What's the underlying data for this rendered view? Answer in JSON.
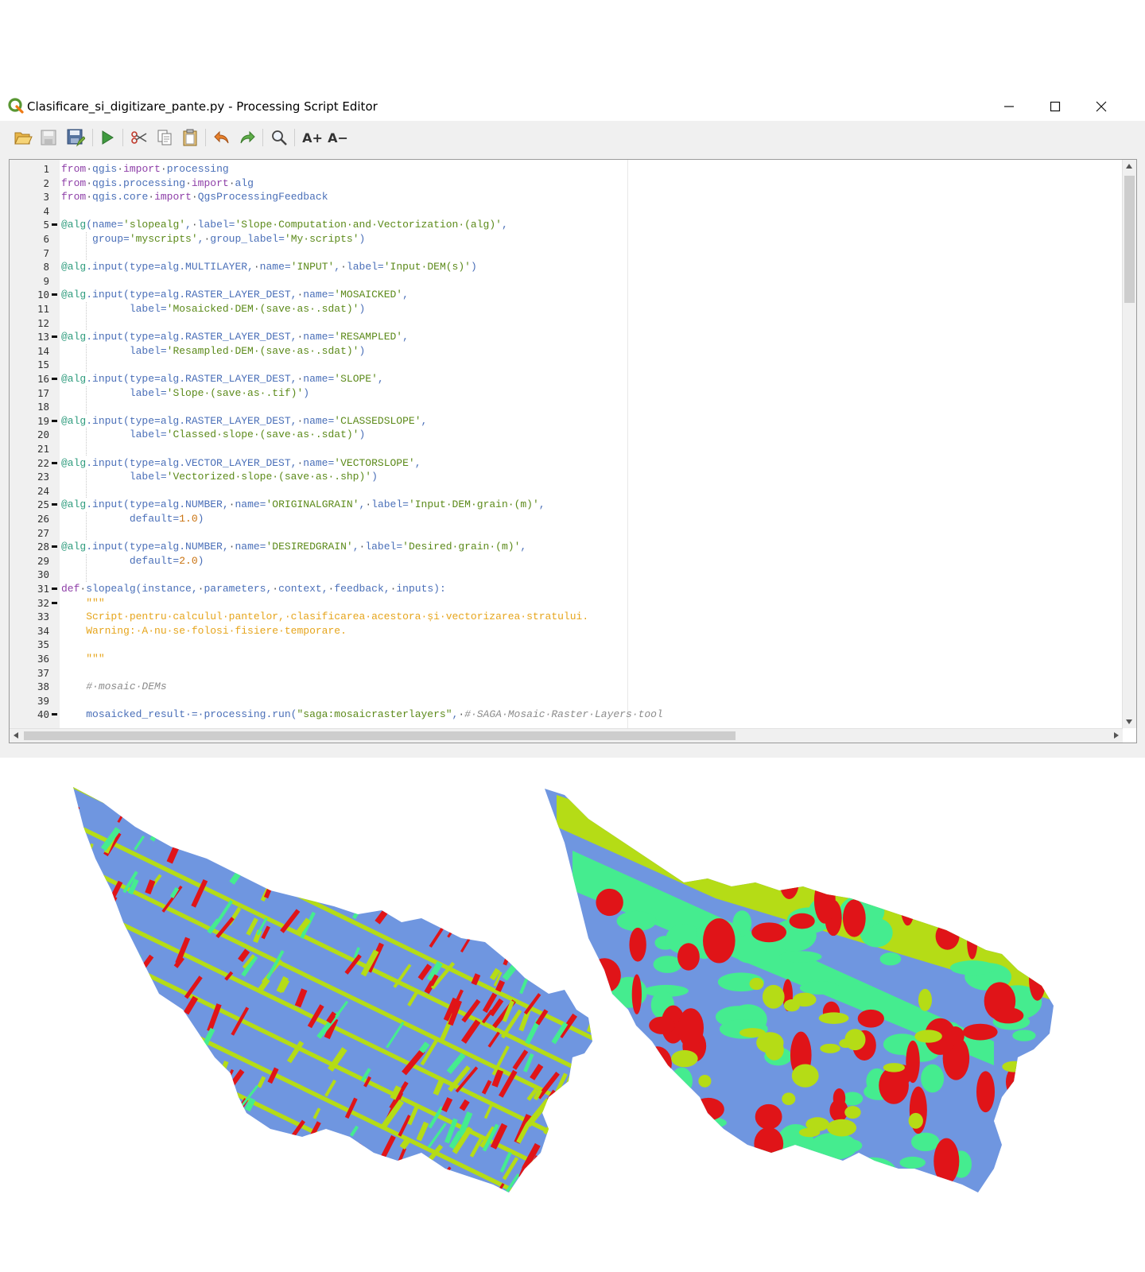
{
  "window": {
    "title": "Clasificare_si_digitizare_pante.py - Processing Script Editor",
    "controls": [
      "minimize",
      "maximize",
      "close"
    ]
  },
  "toolbar": {
    "buttons": [
      {
        "name": "open-script",
        "icon": "folder-open-icon"
      },
      {
        "name": "save-script",
        "icon": "save-icon"
      },
      {
        "name": "save-script-as",
        "icon": "save-as-icon"
      },
      {
        "name": "run-script",
        "icon": "run-icon"
      },
      {
        "name": "cut",
        "icon": "cut-icon"
      },
      {
        "name": "copy",
        "icon": "copy-icon"
      },
      {
        "name": "paste",
        "icon": "paste-icon"
      },
      {
        "name": "undo",
        "icon": "undo-icon"
      },
      {
        "name": "redo",
        "icon": "redo-icon"
      },
      {
        "name": "find-replace",
        "icon": "search-icon"
      },
      {
        "name": "increase-font",
        "label": "A+"
      },
      {
        "name": "decrease-font",
        "label": "A−"
      }
    ]
  },
  "editor": {
    "line_numbers": [
      "1",
      "2",
      "3",
      "4",
      "5",
      "6",
      "7",
      "8",
      "9",
      "10",
      "11",
      "12",
      "13",
      "14",
      "15",
      "16",
      "17",
      "18",
      "19",
      "20",
      "21",
      "22",
      "23",
      "24",
      "25",
      "26",
      "27",
      "28",
      "29",
      "30",
      "31",
      "32",
      "33",
      "34",
      "35",
      "36",
      "37",
      "38",
      "39",
      "40"
    ],
    "fold_lines": [
      5,
      10,
      13,
      16,
      19,
      22,
      25,
      28,
      31,
      32,
      40
    ],
    "lines": [
      [
        [
          "k",
          "from"
        ],
        [
          "p",
          "·"
        ],
        [
          "n",
          "qgis"
        ],
        [
          "p",
          "·"
        ],
        [
          "k",
          "import"
        ],
        [
          "p",
          "·"
        ],
        [
          "n",
          "processing"
        ]
      ],
      [
        [
          "k",
          "from"
        ],
        [
          "p",
          "·"
        ],
        [
          "n",
          "qgis.processing"
        ],
        [
          "p",
          "·"
        ],
        [
          "k",
          "import"
        ],
        [
          "p",
          "·"
        ],
        [
          "n",
          "alg"
        ]
      ],
      [
        [
          "k",
          "from"
        ],
        [
          "p",
          "·"
        ],
        [
          "n",
          "qgis.core"
        ],
        [
          "p",
          "·"
        ],
        [
          "k",
          "import"
        ],
        [
          "p",
          "·"
        ],
        [
          "n",
          "QgsProcessingFeedback"
        ]
      ],
      [],
      [
        [
          "d",
          "@alg"
        ],
        [
          "n",
          "(name="
        ],
        [
          "s",
          "'slopealg'"
        ],
        [
          "n",
          ","
        ],
        [
          "p",
          "·"
        ],
        [
          "n",
          "label="
        ],
        [
          "s",
          "'Slope·Computation·and·Vectorization·(alg)'"
        ],
        [
          "n",
          ","
        ]
      ],
      [
        [
          "p",
          "     "
        ],
        [
          "n",
          "group="
        ],
        [
          "s",
          "'myscripts'"
        ],
        [
          "n",
          ","
        ],
        [
          "p",
          "·"
        ],
        [
          "n",
          "group_label="
        ],
        [
          "s",
          "'My·scripts'"
        ],
        [
          "n",
          ")"
        ]
      ],
      [],
      [
        [
          "d",
          "@alg"
        ],
        [
          "n",
          ".input(type=alg.MULTILAYER,"
        ],
        [
          "p",
          "·"
        ],
        [
          "n",
          "name="
        ],
        [
          "s",
          "'INPUT'"
        ],
        [
          "n",
          ","
        ],
        [
          "p",
          "·"
        ],
        [
          "n",
          "label="
        ],
        [
          "s",
          "'Input·DEM(s)'"
        ],
        [
          "n",
          ")"
        ]
      ],
      [],
      [
        [
          "d",
          "@alg"
        ],
        [
          "n",
          ".input(type=alg.RASTER_LAYER_DEST,"
        ],
        [
          "p",
          "·"
        ],
        [
          "n",
          "name="
        ],
        [
          "s",
          "'MOSAICKED'"
        ],
        [
          "n",
          ","
        ]
      ],
      [
        [
          "p",
          "           "
        ],
        [
          "n",
          "label="
        ],
        [
          "s",
          "'Mosaicked·DEM·(save·as·.sdat)'"
        ],
        [
          "n",
          ")"
        ]
      ],
      [],
      [
        [
          "d",
          "@alg"
        ],
        [
          "n",
          ".input(type=alg.RASTER_LAYER_DEST,"
        ],
        [
          "p",
          "·"
        ],
        [
          "n",
          "name="
        ],
        [
          "s",
          "'RESAMPLED'"
        ],
        [
          "n",
          ","
        ]
      ],
      [
        [
          "p",
          "           "
        ],
        [
          "n",
          "label="
        ],
        [
          "s",
          "'Resampled·DEM·(save·as·.sdat)'"
        ],
        [
          "n",
          ")"
        ]
      ],
      [],
      [
        [
          "d",
          "@alg"
        ],
        [
          "n",
          ".input(type=alg.RASTER_LAYER_DEST,"
        ],
        [
          "p",
          "·"
        ],
        [
          "n",
          "name="
        ],
        [
          "s",
          "'SLOPE'"
        ],
        [
          "n",
          ","
        ]
      ],
      [
        [
          "p",
          "           "
        ],
        [
          "n",
          "label="
        ],
        [
          "s",
          "'Slope·(save·as·.tif)'"
        ],
        [
          "n",
          ")"
        ]
      ],
      [],
      [
        [
          "d",
          "@alg"
        ],
        [
          "n",
          ".input(type=alg.RASTER_LAYER_DEST,"
        ],
        [
          "p",
          "·"
        ],
        [
          "n",
          "name="
        ],
        [
          "s",
          "'CLASSEDSLOPE'"
        ],
        [
          "n",
          ","
        ]
      ],
      [
        [
          "p",
          "           "
        ],
        [
          "n",
          "label="
        ],
        [
          "s",
          "'Classed·slope·(save·as·.sdat)'"
        ],
        [
          "n",
          ")"
        ]
      ],
      [],
      [
        [
          "d",
          "@alg"
        ],
        [
          "n",
          ".input(type=alg.VECTOR_LAYER_DEST,"
        ],
        [
          "p",
          "·"
        ],
        [
          "n",
          "name="
        ],
        [
          "s",
          "'VECTORSLOPE'"
        ],
        [
          "n",
          ","
        ]
      ],
      [
        [
          "p",
          "           "
        ],
        [
          "n",
          "label="
        ],
        [
          "s",
          "'Vectorized·slope·(save·as·.shp)'"
        ],
        [
          "n",
          ")"
        ]
      ],
      [],
      [
        [
          "d",
          "@alg"
        ],
        [
          "n",
          ".input(type=alg.NUMBER,"
        ],
        [
          "p",
          "·"
        ],
        [
          "n",
          "name="
        ],
        [
          "s",
          "'ORIGINALGRAIN'"
        ],
        [
          "n",
          ","
        ],
        [
          "p",
          "·"
        ],
        [
          "n",
          "label="
        ],
        [
          "s",
          "'Input·DEM·grain·(m)'"
        ],
        [
          "n",
          ","
        ]
      ],
      [
        [
          "p",
          "           "
        ],
        [
          "n",
          "default="
        ],
        [
          "num",
          "1.0"
        ],
        [
          "n",
          ")"
        ]
      ],
      [],
      [
        [
          "d",
          "@alg"
        ],
        [
          "n",
          ".input(type=alg.NUMBER,"
        ],
        [
          "p",
          "·"
        ],
        [
          "n",
          "name="
        ],
        [
          "s",
          "'DESIREDGRAIN'"
        ],
        [
          "n",
          ","
        ],
        [
          "p",
          "·"
        ],
        [
          "n",
          "label="
        ],
        [
          "s",
          "'Desired·grain·(m)'"
        ],
        [
          "n",
          ","
        ]
      ],
      [
        [
          "p",
          "           "
        ],
        [
          "n",
          "default="
        ],
        [
          "num",
          "2.0"
        ],
        [
          "n",
          ")"
        ]
      ],
      [],
      [
        [
          "k",
          "def"
        ],
        [
          "p",
          "·"
        ],
        [
          "n",
          "slopealg(instance,"
        ],
        [
          "p",
          "·"
        ],
        [
          "n",
          "parameters,"
        ],
        [
          "p",
          "·"
        ],
        [
          "n",
          "context,"
        ],
        [
          "p",
          "·"
        ],
        [
          "n",
          "feedback,"
        ],
        [
          "p",
          "·"
        ],
        [
          "n",
          "inputs):"
        ]
      ],
      [
        [
          "p",
          "    "
        ],
        [
          "doc",
          "\"\"\""
        ]
      ],
      [
        [
          "p",
          "    "
        ],
        [
          "doc",
          "Script·pentru·calculul·pantelor,·clasificarea·acestora·și·vectorizarea·stratului."
        ]
      ],
      [
        [
          "p",
          "    "
        ],
        [
          "doc",
          "Warning:·A·nu·se·folosi·fisiere·temporare."
        ]
      ],
      [],
      [
        [
          "p",
          "    "
        ],
        [
          "doc",
          "\"\"\""
        ]
      ],
      [],
      [
        [
          "p",
          "    "
        ],
        [
          "cm",
          "#·mosaic·DEMs"
        ]
      ],
      [],
      [
        [
          "p",
          "    "
        ],
        [
          "n",
          "mosaicked_result·=·processing.run("
        ],
        [
          "s",
          "\"saga:mosaicrasterlayers\""
        ],
        [
          "n",
          ","
        ],
        [
          "p",
          "·"
        ],
        [
          "cm",
          "#·SAGA·Mosaic·Raster·Layers·tool"
        ]
      ]
    ]
  },
  "maps": {
    "panels": [
      "slope-map-original",
      "slope-map-generalized"
    ],
    "class_colors": {
      "class1": "#b5dc16",
      "class2": "#45ec8f",
      "class3": "#6f96e0",
      "class4": "#e01418"
    }
  }
}
